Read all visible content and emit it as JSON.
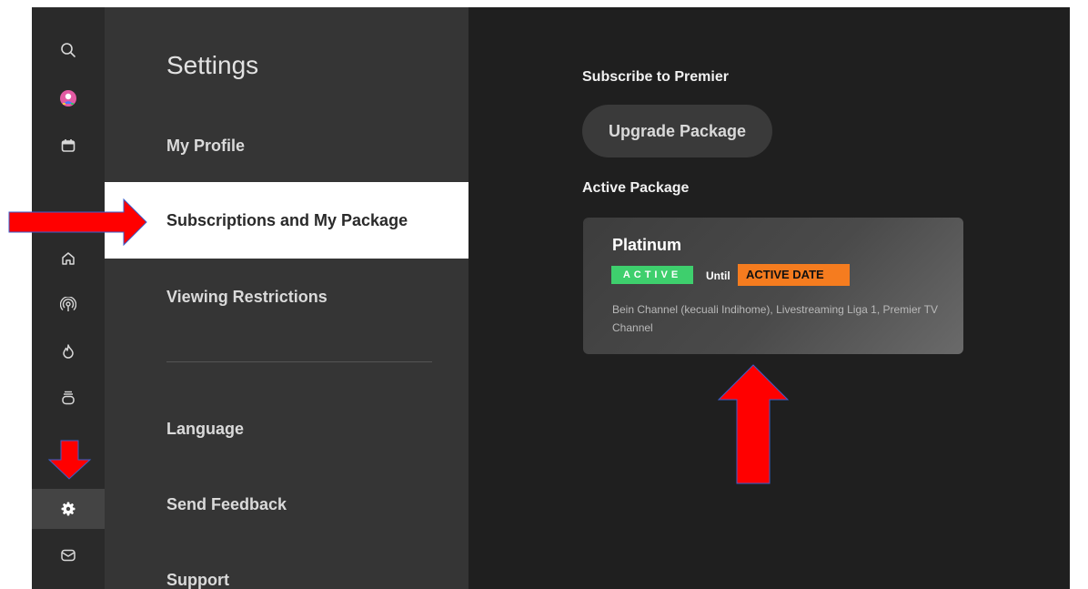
{
  "menu": {
    "title": "Settings",
    "items": [
      {
        "label": "My Profile"
      },
      {
        "label": "Subscriptions and My Package"
      },
      {
        "label": "Viewing Restrictions"
      },
      {
        "label": "Language"
      },
      {
        "label": "Send Feedback"
      },
      {
        "label": "Support"
      }
    ],
    "selected_index": 1
  },
  "rail": {
    "icons": [
      "search-icon",
      "profile-avatar-icon",
      "calendar-icon",
      "home-icon",
      "live-broadcast-icon",
      "flame-icon",
      "stack-icon",
      "settings-gear-icon",
      "mail-icon"
    ],
    "active_icon": "settings-gear-icon"
  },
  "main": {
    "subscribe_heading": "Subscribe to Premier",
    "upgrade_button": "Upgrade Package",
    "active_heading": "Active Package",
    "package": {
      "name": "Platinum",
      "status": "ACTIVE",
      "until_label": "Until",
      "active_date": "ACTIVE DATE",
      "description": "Bein Channel (kecuali Indihome), Livestreaming Liga 1, Premier TV Channel"
    }
  },
  "colors": {
    "rail_bg": "#2a2a2a",
    "menu_bg": "#353535",
    "main_bg": "#1f1f1f",
    "selected_bg": "#ffffff",
    "status_green": "#3ecf6d",
    "date_orange": "#f57c1f",
    "annotation_red": "#ff0000"
  }
}
